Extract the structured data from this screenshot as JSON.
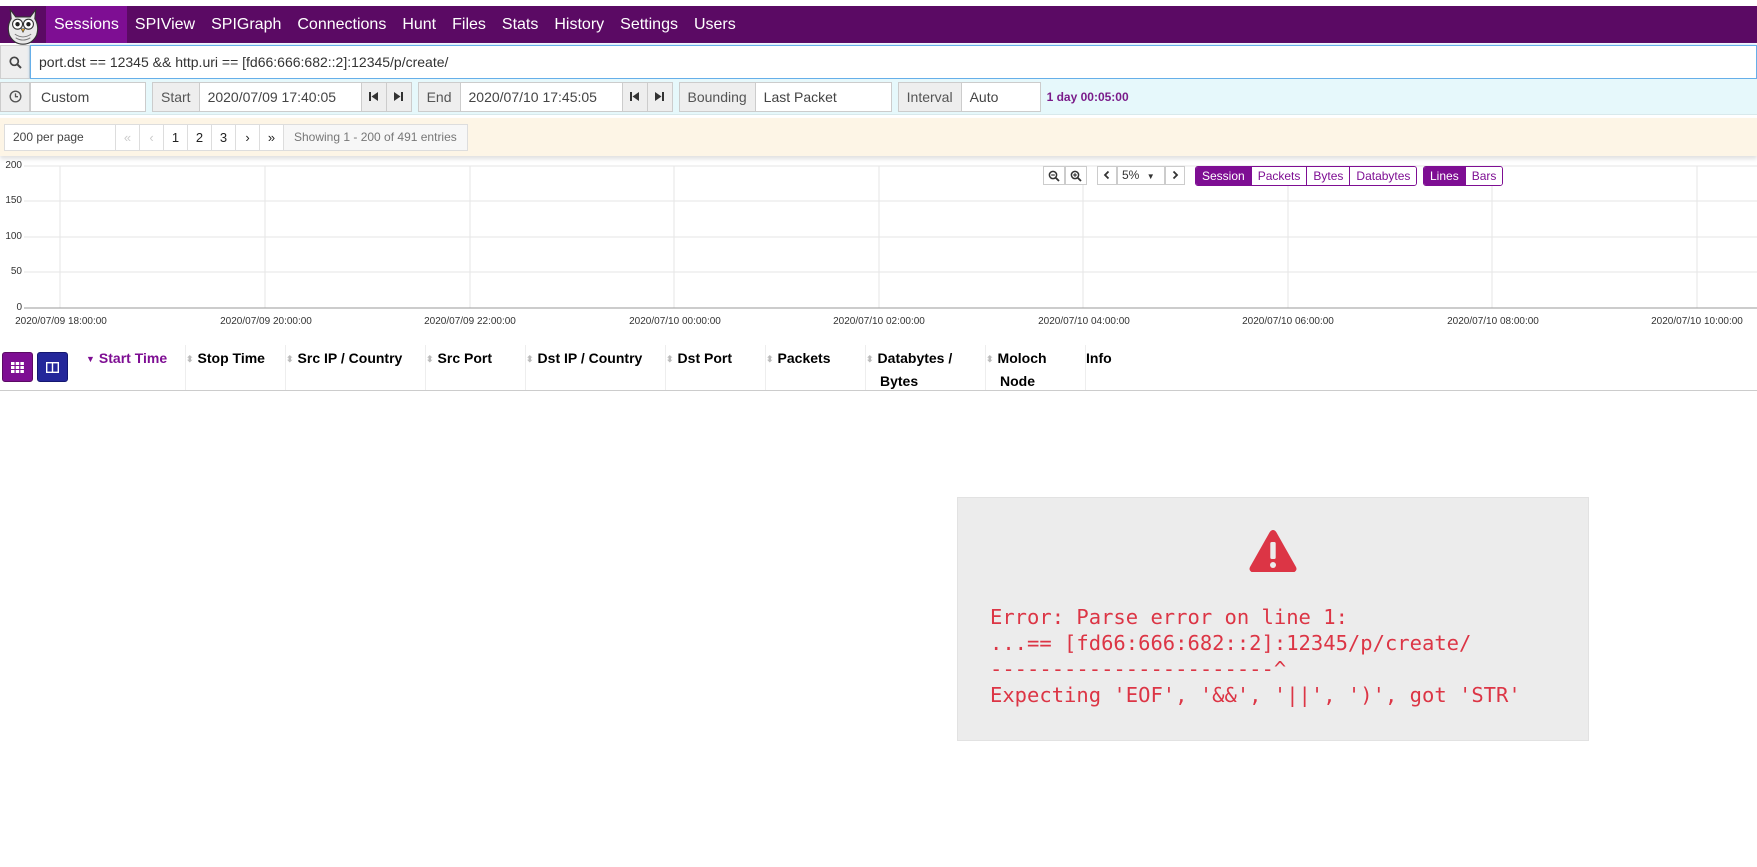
{
  "nav": {
    "items": [
      {
        "label": "Sessions",
        "active": true
      },
      {
        "label": "SPIView"
      },
      {
        "label": "SPIGraph"
      },
      {
        "label": "Connections"
      },
      {
        "label": "Hunt"
      },
      {
        "label": "Files"
      },
      {
        "label": "Stats"
      },
      {
        "label": "History"
      },
      {
        "label": "Settings"
      },
      {
        "label": "Users"
      }
    ]
  },
  "search": {
    "value": "port.dst == 12345 && http.uri == [fd66:666:682::2]:12345/p/create/"
  },
  "time": {
    "range": "Custom",
    "start_label": "Start",
    "start_value": "2020/07/09 17:40:05",
    "end_label": "End",
    "end_value": "2020/07/10 17:45:05",
    "bounding_label": "Bounding",
    "bounding_value": "Last Packet",
    "interval_label": "Interval",
    "interval_value": "Auto",
    "duration": "1 day 00:05:00"
  },
  "paging": {
    "per_page": "200 per page",
    "first": "«",
    "prev": "‹",
    "pages": [
      "1",
      "2",
      "3"
    ],
    "next": "›",
    "last": "»",
    "info": "Showing 1 - 200 of 491 entries"
  },
  "graph": {
    "y_ticks": [
      "200",
      "150",
      "100",
      "50",
      "0"
    ],
    "x_ticks": [
      "2020/07/09 18:00:00",
      "2020/07/09 20:00:00",
      "2020/07/09 22:00:00",
      "2020/07/10 00:00:00",
      "2020/07/10 02:00:00",
      "2020/07/10 04:00:00",
      "2020/07/10 06:00:00",
      "2020/07/10 08:00:00",
      "2020/07/10 10:00:00"
    ],
    "zoom": "5%",
    "type_buttons": [
      "Session",
      "Packets",
      "Bytes",
      "Databytes"
    ],
    "type_selected": "Session",
    "style_buttons": [
      "Lines",
      "Bars"
    ],
    "style_selected": "Lines"
  },
  "table": {
    "columns": [
      {
        "label": "Start Time",
        "active": true
      },
      {
        "label": "Stop Time"
      },
      {
        "label": "Src IP / Country"
      },
      {
        "label": "Src Port"
      },
      {
        "label": "Dst IP / Country"
      },
      {
        "label": "Dst Port"
      },
      {
        "label": "Packets"
      },
      {
        "label": "Databytes / Bytes"
      },
      {
        "label": "Moloch Node"
      },
      {
        "label": "Info"
      }
    ]
  },
  "error": {
    "line1": "Error: Parse error on line 1:",
    "line2": "...== [fd66:666:682::2]:12345/p/create/",
    "line3": "-----------------------^",
    "line4": "Expecting 'EOF', '&&', '||', ')', got 'STR'"
  },
  "colors": {
    "nav_bg": "#5b0a64",
    "nav_active": "#7e0e93",
    "error": "#dc3545",
    "time_bg": "#e6f8fb",
    "page_bg": "#fdf5e6"
  }
}
